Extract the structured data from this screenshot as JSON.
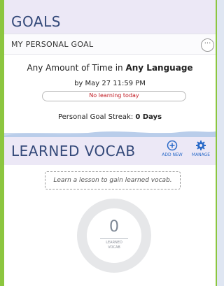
{
  "goals": {
    "title": "GOALS",
    "personal_goal_label": "MY PERSONAL GOAL",
    "more_label": "···",
    "goal_prefix": "Any Amount of Time in ",
    "goal_language": "Any Language",
    "deadline": "by May 27 11:59 PM",
    "progress_status": "No learning today",
    "progress_value": 0,
    "streak_prefix": "Personal Goal Streak: ",
    "streak_value": "0 Days"
  },
  "vocab": {
    "title": "LEARNED VOCAB",
    "add_new_label": "ADD NEW",
    "manage_label": "MANAGE",
    "empty_message": "Learn a lesson to gain learned vocab.",
    "count": "0",
    "count_label_line1": "LEARNED",
    "count_label_line2": "VOCAB"
  },
  "colors": {
    "accent_green": "#8cc63f",
    "header_bg": "#ece8f6",
    "title_blue": "#354a7a",
    "link_blue": "#2a6ac8",
    "alert_red": "#c0171f"
  },
  "icons": {
    "more": "ellipsis-icon",
    "add_new": "plus-circle-icon",
    "manage": "gear-icon"
  }
}
